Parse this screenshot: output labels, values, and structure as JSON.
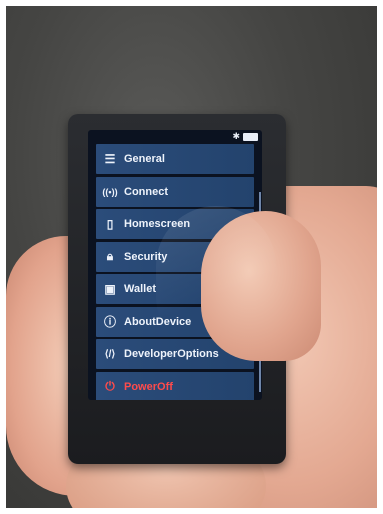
{
  "status": {
    "bluetooth_icon": "bluetooth-icon",
    "battery_icon": "battery-icon"
  },
  "menu": {
    "items": [
      {
        "label": "General",
        "icon": "sliders-icon",
        "glyph": "☰"
      },
      {
        "label": "Connect",
        "icon": "wireless-icon",
        "glyph": "((•))"
      },
      {
        "label": "Homescreen",
        "icon": "phone-icon",
        "glyph": "▯"
      },
      {
        "label": "Security",
        "icon": "lock-icon",
        "glyph": "🔒︎"
      },
      {
        "label": "Wallet",
        "icon": "wallet-icon",
        "glyph": "▣"
      },
      {
        "label": "AboutDevice",
        "icon": "info-icon",
        "glyph": "ⓘ"
      },
      {
        "label": "DeveloperOptions",
        "icon": "code-icon",
        "glyph": "⟨/⟩"
      },
      {
        "label": "PowerOff",
        "icon": "power-icon",
        "glyph": "⏻"
      }
    ]
  },
  "colors": {
    "item_bg": "#2b4c7a",
    "text": "#eef3fb",
    "danger": "#ff4b4b"
  }
}
